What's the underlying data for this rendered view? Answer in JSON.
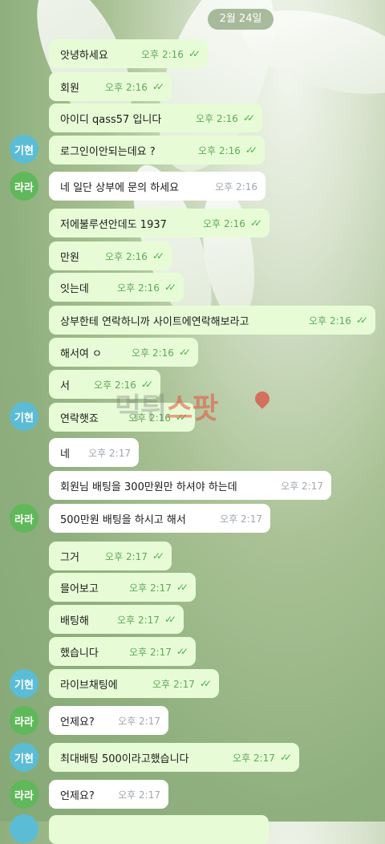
{
  "date_chip": "2월 24일",
  "avatars": {
    "blue_initials": "기현",
    "green_initials": "라라"
  },
  "messages": [
    {
      "text": "앗녕하세요",
      "time": "오후 2:16",
      "dir": "out"
    },
    {
      "text": "회원",
      "time": "오후 2:16",
      "dir": "out"
    },
    {
      "text": "아이디 qass57 입니다",
      "time": "오후 2:16",
      "dir": "out"
    },
    {
      "text": "로그인이안되는데요 ?",
      "time": "오후 2:16",
      "dir": "out"
    },
    {
      "text": "네 일단 상부에 문의 하세요",
      "time": "오후 2:16",
      "dir": "in"
    },
    {
      "text": "저에불루션안데도 1937",
      "time": "오후 2:16",
      "dir": "out"
    },
    {
      "text": "만원",
      "time": "오후 2:16",
      "dir": "out"
    },
    {
      "text": "잇는데",
      "time": "오후 2:16",
      "dir": "out"
    },
    {
      "text": "상부한테 연락하니까 사이트에연락해보라고",
      "time": "오후 2:16",
      "dir": "out"
    },
    {
      "text": "해서여 ㅇ",
      "time": "오후 2:16",
      "dir": "out"
    },
    {
      "text": "서",
      "time": "오후 2:16",
      "dir": "out"
    },
    {
      "text": "연락햇죠",
      "time": "오후 2:16",
      "dir": "out"
    },
    {
      "text": "네",
      "time": "오후 2:17",
      "dir": "in"
    },
    {
      "text": "회원님 배팅을 300만원만 하셔야 하는데",
      "time": "오후 2:17",
      "dir": "in"
    },
    {
      "text": "500만원 배팅을 하시고 해서",
      "time": "오후 2:17",
      "dir": "in"
    },
    {
      "text": "그거",
      "time": "오후 2:17",
      "dir": "out"
    },
    {
      "text": "믈어보고",
      "time": "오후 2:17",
      "dir": "out"
    },
    {
      "text": "배팅해",
      "time": "오후 2:17",
      "dir": "out"
    },
    {
      "text": "했습니다",
      "time": "오후 2:17",
      "dir": "out"
    },
    {
      "text": "라이브채팅에",
      "time": "오후 2:17",
      "dir": "out"
    },
    {
      "text": "언제요?",
      "time": "오후 2:17",
      "dir": "in"
    },
    {
      "text": "최대배팅 500이라고했습니다",
      "time": "오후 2:17",
      "dir": "out"
    },
    {
      "text": "언제요?",
      "time": "오후 2:17",
      "dir": "in"
    }
  ],
  "watermark": {
    "part1": "먹튀",
    "part2": "스팟"
  }
}
